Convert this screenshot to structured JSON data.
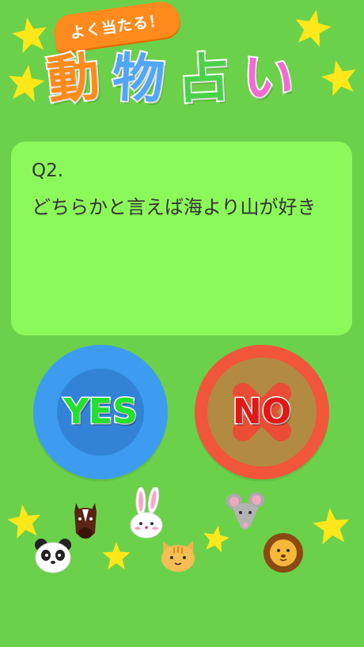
{
  "header": {
    "tagline": "よく当たる！",
    "title_chars": [
      {
        "char": "動",
        "color": "#ff8c1a"
      },
      {
        "char": "物",
        "color": "#4fa7f5"
      },
      {
        "char": "占",
        "color": "#4ad14a"
      },
      {
        "char": "い",
        "color": "#f06cd0"
      }
    ]
  },
  "question": {
    "number": "Q2.",
    "text": "どちらかと言えば海より山が好き"
  },
  "buttons": {
    "yes_label": "YES",
    "no_label": "NO"
  },
  "colors": {
    "background": "#6cd14a",
    "card": "#8cf95a",
    "yes": "#3e9cf0",
    "no": "#f1553a",
    "star": "#ffe81a"
  },
  "decorations": {
    "animals": [
      "panda-icon",
      "horse-icon",
      "rabbit-icon",
      "cat-icon",
      "mouse-icon",
      "lion-icon"
    ]
  }
}
